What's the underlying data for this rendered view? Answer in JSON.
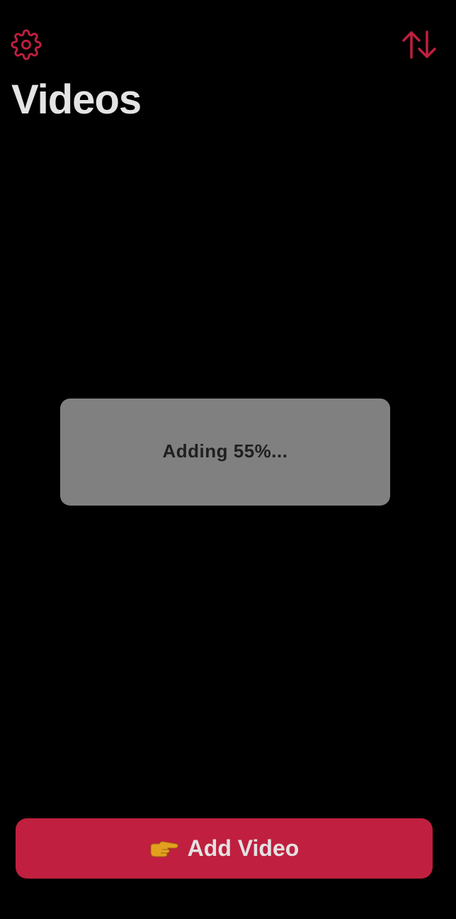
{
  "header": {
    "title": "Videos",
    "settings_icon": "gear-icon",
    "sort_icon": "sort-arrows-icon"
  },
  "progress": {
    "text": "Adding 55%...",
    "percent": 55
  },
  "add_button": {
    "label": "Add Video",
    "icon": "pointing-hand-icon"
  },
  "colors": {
    "accent": "#c01f3f",
    "background": "#000000",
    "toast_bg": "#808080",
    "title_text": "#e4e4e4",
    "toast_text": "#1f1f1f"
  }
}
